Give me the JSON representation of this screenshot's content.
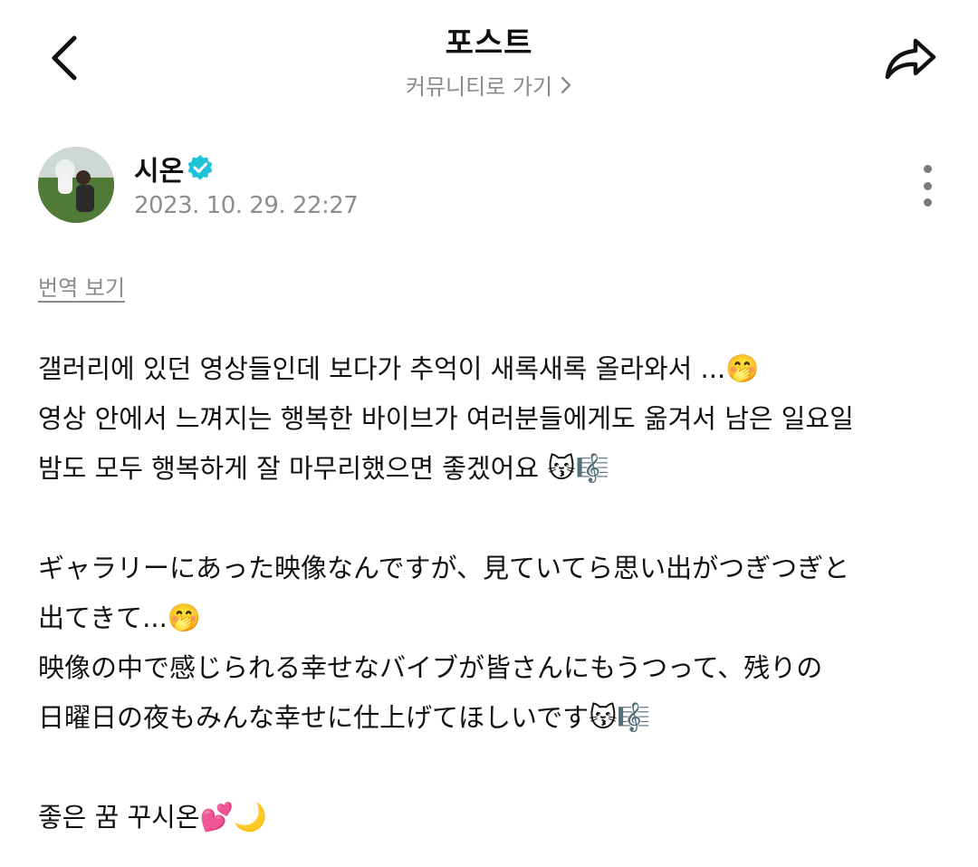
{
  "header": {
    "title": "포스트",
    "community_link": "커뮤니티로 가기",
    "icons": {
      "back": "chevron-left-icon",
      "share": "share-arrow-icon",
      "community_chevron": "chevron-right-icon"
    }
  },
  "author": {
    "name": "시온",
    "verified_color": "#1ec3d8",
    "timestamp": "2023. 10. 29. 22:27"
  },
  "translate_label": "번역 보기",
  "post": {
    "lines": [
      {
        "text": "갤러리에 있던 영상들인데 보다가 추억이 새록새록 올라와서 ...",
        "emoji": "🤭"
      },
      {
        "text": "영상 안에서 느껴지는 행복한 바이브가 여러분들에게도 옮겨서 남은 일요일",
        "emoji": ""
      },
      {
        "text": "밤도 모두 행복하게 잘 마무리했으면 좋겠어요 ",
        "emoji": "😽🎼"
      },
      {
        "text": "ギャラリーにあった映像なんですが、見ていてら思い出がつぎつぎと",
        "emoji": ""
      },
      {
        "text": "出てきて...",
        "emoji": "🤭"
      },
      {
        "text": "映像の中で感じられる幸せなバイブが皆さんにもうつって、残りの",
        "emoji": ""
      },
      {
        "text": "日曜日の夜もみんな幸せに仕上げてほしいです",
        "emoji": "😽🎼"
      },
      {
        "text": "좋은 꿈 꾸시온",
        "emoji": "💕🌙"
      }
    ]
  }
}
